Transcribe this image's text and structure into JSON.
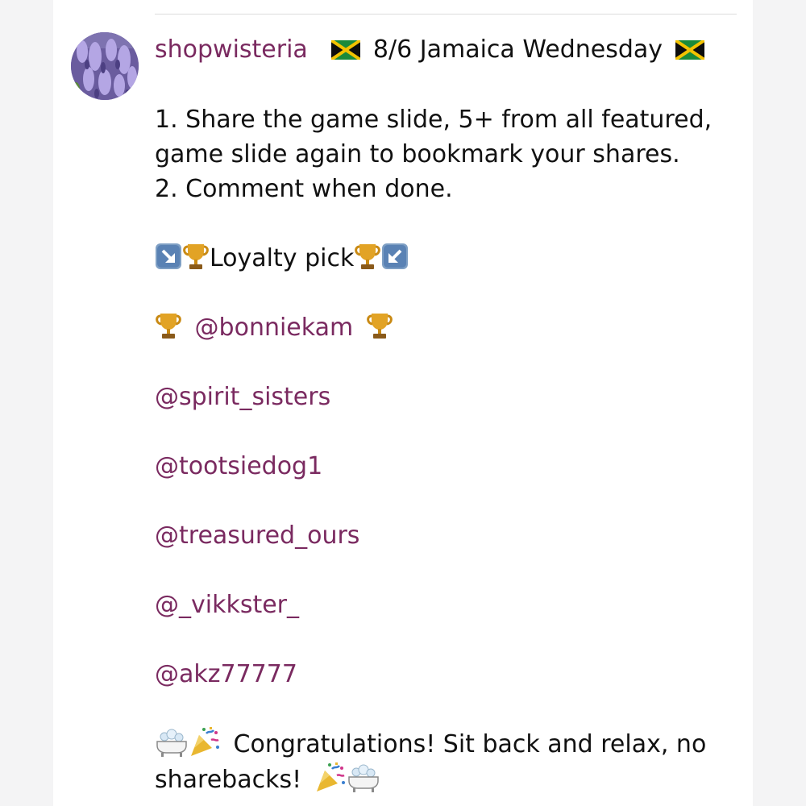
{
  "post": {
    "username": "shopwisteria",
    "title": "8/6 Jamaica Wednesday",
    "instructions": [
      "1. Share the game slide, 5+ from all featured,",
      "game slide again to bookmark your shares.",
      "2. Comment when done."
    ],
    "loyalty_label": "Loyalty pick",
    "loyalty_pick": "@bonniekam",
    "featured": [
      "@spirit_sisters",
      "@tootsiedog1",
      "@treasured_ours",
      "@_vikkster_",
      "@akz77777"
    ],
    "closing_line1": "Congratulations! Sit back and relax, no",
    "closing_line2": "sharebacks!"
  },
  "icons": {
    "flag": "jamaica-flag-icon",
    "trophy": "trophy-icon",
    "arrow_down_right": "arrow-down-right-icon",
    "arrow_down_left": "arrow-down-left-icon",
    "party": "party-popper-icon",
    "bathtub": "bathtub-icon"
  },
  "colors": {
    "username": "#7a2a60",
    "mention": "#7a2a60",
    "text": "#111111"
  }
}
